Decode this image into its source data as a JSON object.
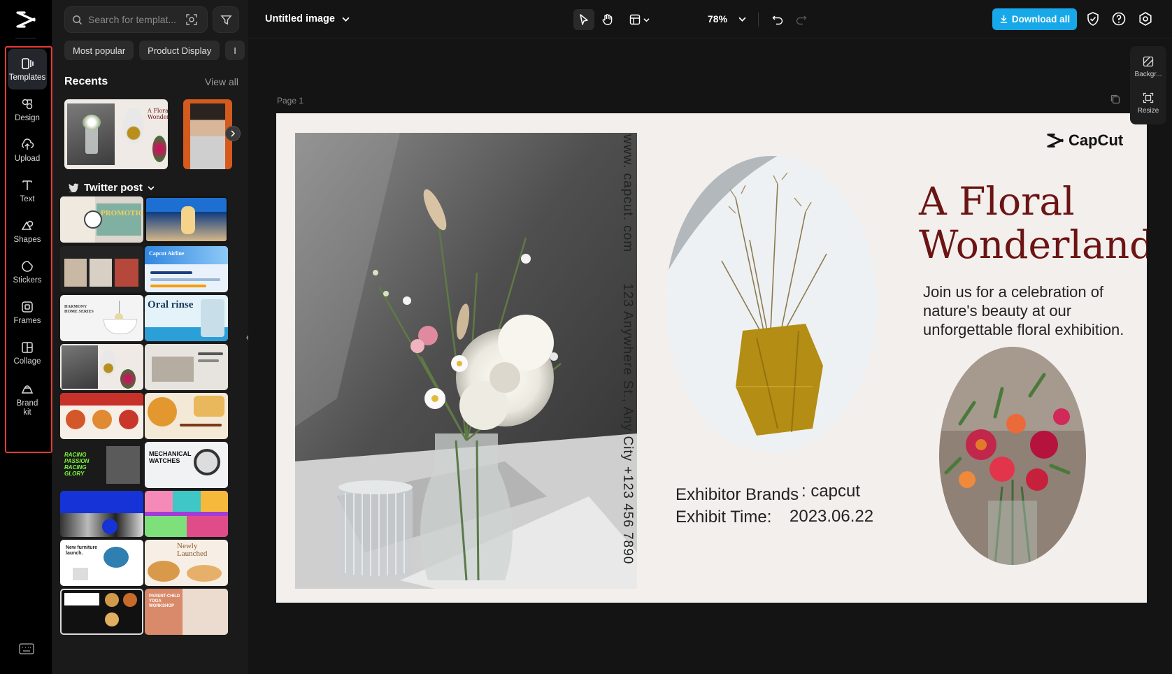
{
  "rail": {
    "items": [
      {
        "label": "Templates",
        "icon": "templates-icon"
      },
      {
        "label": "Design",
        "icon": "design-icon"
      },
      {
        "label": "Upload",
        "icon": "upload-icon"
      },
      {
        "label": "Text",
        "icon": "text-icon"
      },
      {
        "label": "Shapes",
        "icon": "shapes-icon"
      },
      {
        "label": "Stickers",
        "icon": "stickers-icon"
      },
      {
        "label": "Frames",
        "icon": "frames-icon"
      },
      {
        "label": "Collage",
        "icon": "collage-icon"
      },
      {
        "label": "Brand\nkit",
        "icon": "brand-kit-icon"
      }
    ]
  },
  "panel": {
    "search_placeholder": "Search for templat...",
    "chips": [
      "Most popular",
      "Product Display",
      "I"
    ],
    "recents_title": "Recents",
    "view_all": "View all",
    "category_title": "Twitter post",
    "thumbs": {
      "promotion": "PROMOTION",
      "oral": "Oral rinse",
      "harmony": "HARMONY HOME SERIES",
      "watches": "MECHANICAL WATCHES",
      "racing": "RACING PASSION RACING GLORY",
      "furniture": "New furniture launch.",
      "launched": "Newly Launched",
      "yoga": "PARENT-CHILD YOGA WORKSHOP",
      "floral": "A Floral Wonderland",
      "airline": "Capcut Airline"
    }
  },
  "topbar": {
    "doc_title": "Untitled image",
    "zoom": "78%",
    "download_label": "Download all"
  },
  "right_tools": {
    "background": "Backgr...",
    "resize": "Resize"
  },
  "canvas": {
    "page_label": "Page 1",
    "brand": "CapCut",
    "vertical_url": "www. capcut. com",
    "vertical_address": "123 Anywhere St., Any City",
    "vertical_phone": "+123 456 7890",
    "headline_1": "A Floral",
    "headline_2": "Wonderland",
    "description": "Join us for a celebration of nature's beauty at our unforgettable floral exhibition.",
    "exhibitor_label": "Exhibitor Brands",
    "exhibitor_value": ": capcut",
    "time_label": "Exhibit Time:",
    "time_value": "2023.06.22"
  },
  "colors": {
    "accent": "#16a8e8",
    "headline": "#6b1414",
    "page_bg": "#f3efec",
    "highlight_frame": "#e53935"
  }
}
